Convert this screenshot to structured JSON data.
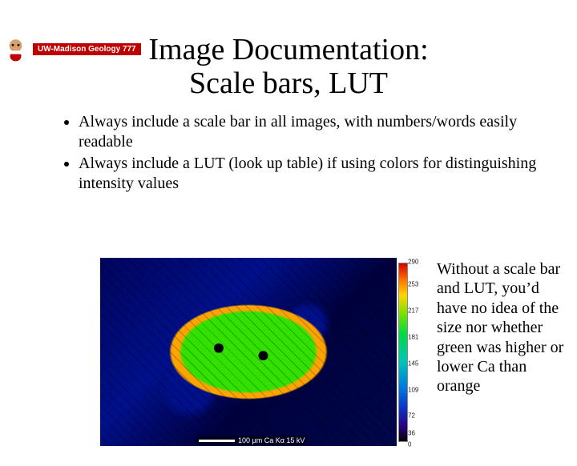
{
  "header": {
    "chip": "UW-Madison Geology 777"
  },
  "title_line1": "Image Documentation:",
  "title_line2": "Scale bars, LUT",
  "bullets": [
    "Always include a scale bar in all images, with numbers/words easily readable",
    "Always include a LUT (look up table) if using colors for distinguishing intensity values"
  ],
  "caption": "Without a scale bar and LUT, you’d have no idea of the size nor whether green was higher or lower Ca than orange",
  "scalebar_text": "100 µm  Ca Kα  15 kV",
  "lut": {
    "ticks": [
      {
        "pct": 2,
        "label": "290"
      },
      {
        "pct": 14,
        "label": "253"
      },
      {
        "pct": 28,
        "label": "217"
      },
      {
        "pct": 42,
        "label": "181"
      },
      {
        "pct": 56,
        "label": "145"
      },
      {
        "pct": 70,
        "label": "109"
      },
      {
        "pct": 84,
        "label": "72"
      },
      {
        "pct": 93,
        "label": "36"
      },
      {
        "pct": 99,
        "label": "0"
      }
    ]
  }
}
